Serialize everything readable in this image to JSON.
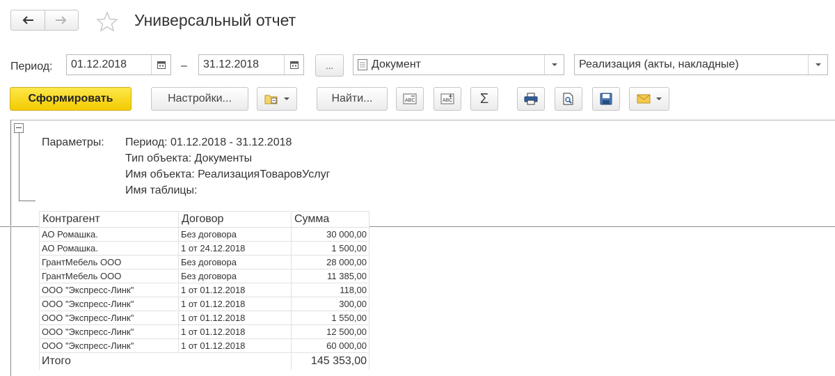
{
  "window": {
    "title": "Универсальный отчет"
  },
  "period": {
    "label": "Период:",
    "from": "01.12.2018",
    "separator": "–",
    "to": "31.12.2018",
    "more_label": "..."
  },
  "object_type": {
    "value": "Документ"
  },
  "object_name": {
    "value": "Реализация (акты, накладные)"
  },
  "toolbar": {
    "generate_label": "Сформировать",
    "settings_label": "Настройки...",
    "find_label": "Найти...",
    "sum_symbol": "Σ"
  },
  "report": {
    "params_label": "Параметры:",
    "param_lines": [
      "Период: 01.12.2018 - 31.12.2018",
      "Тип объекта: Документы",
      "Имя объекта: РеализацияТоваровУслуг",
      "Имя таблицы:"
    ],
    "columns": [
      "Контрагент",
      "Договор",
      "Сумма"
    ],
    "rows": [
      [
        "АО Ромашка.",
        "Без договора",
        "30 000,00"
      ],
      [
        "АО Ромашка.",
        "1 от 24.12.2018",
        "1 500,00"
      ],
      [
        "ГрантМебель ООО",
        "Без договора",
        "28 000,00"
      ],
      [
        "ГрантМебель ООО",
        "Без договора",
        "11 385,00"
      ],
      [
        "ООО \"Экспресс-Линк\"",
        "1 от 01.12.2018",
        "118,00"
      ],
      [
        "ООО \"Экспресс-Линк\"",
        "1 от 01.12.2018",
        "300,00"
      ],
      [
        "ООО \"Экспресс-Линк\"",
        "1 от 01.12.2018",
        "1 550,00"
      ],
      [
        "ООО \"Экспресс-Линк\"",
        "1 от 01.12.2018",
        "12 500,00"
      ],
      [
        "ООО \"Экспресс-Линк\"",
        "1 от 01.12.2018",
        "60 000,00"
      ]
    ],
    "total_label": "Итого",
    "total_value": "145 353,00"
  },
  "colors": {
    "accent_yellow": "#f3cb00",
    "border_gray": "#c6c6c6"
  }
}
